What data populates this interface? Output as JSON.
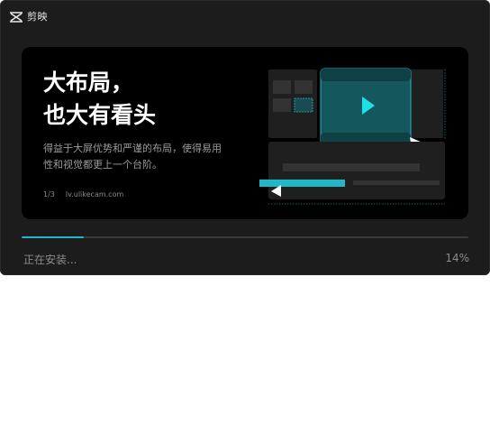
{
  "app": {
    "name": "剪映"
  },
  "banner": {
    "headline_line1": "大布局，",
    "headline_line2": "也大有看头",
    "description": "得益于大屏优势和严谨的布局，使得易用性和视觉都更上一个台阶。",
    "page_indicator": "1/3",
    "url": "lv.ulikecam.com"
  },
  "install": {
    "status": "正在安装...",
    "progress": 0.14,
    "percent_label": "14%"
  },
  "colors": {
    "accent": "#1eb8c8",
    "window_bg": "#1c1c1d"
  }
}
